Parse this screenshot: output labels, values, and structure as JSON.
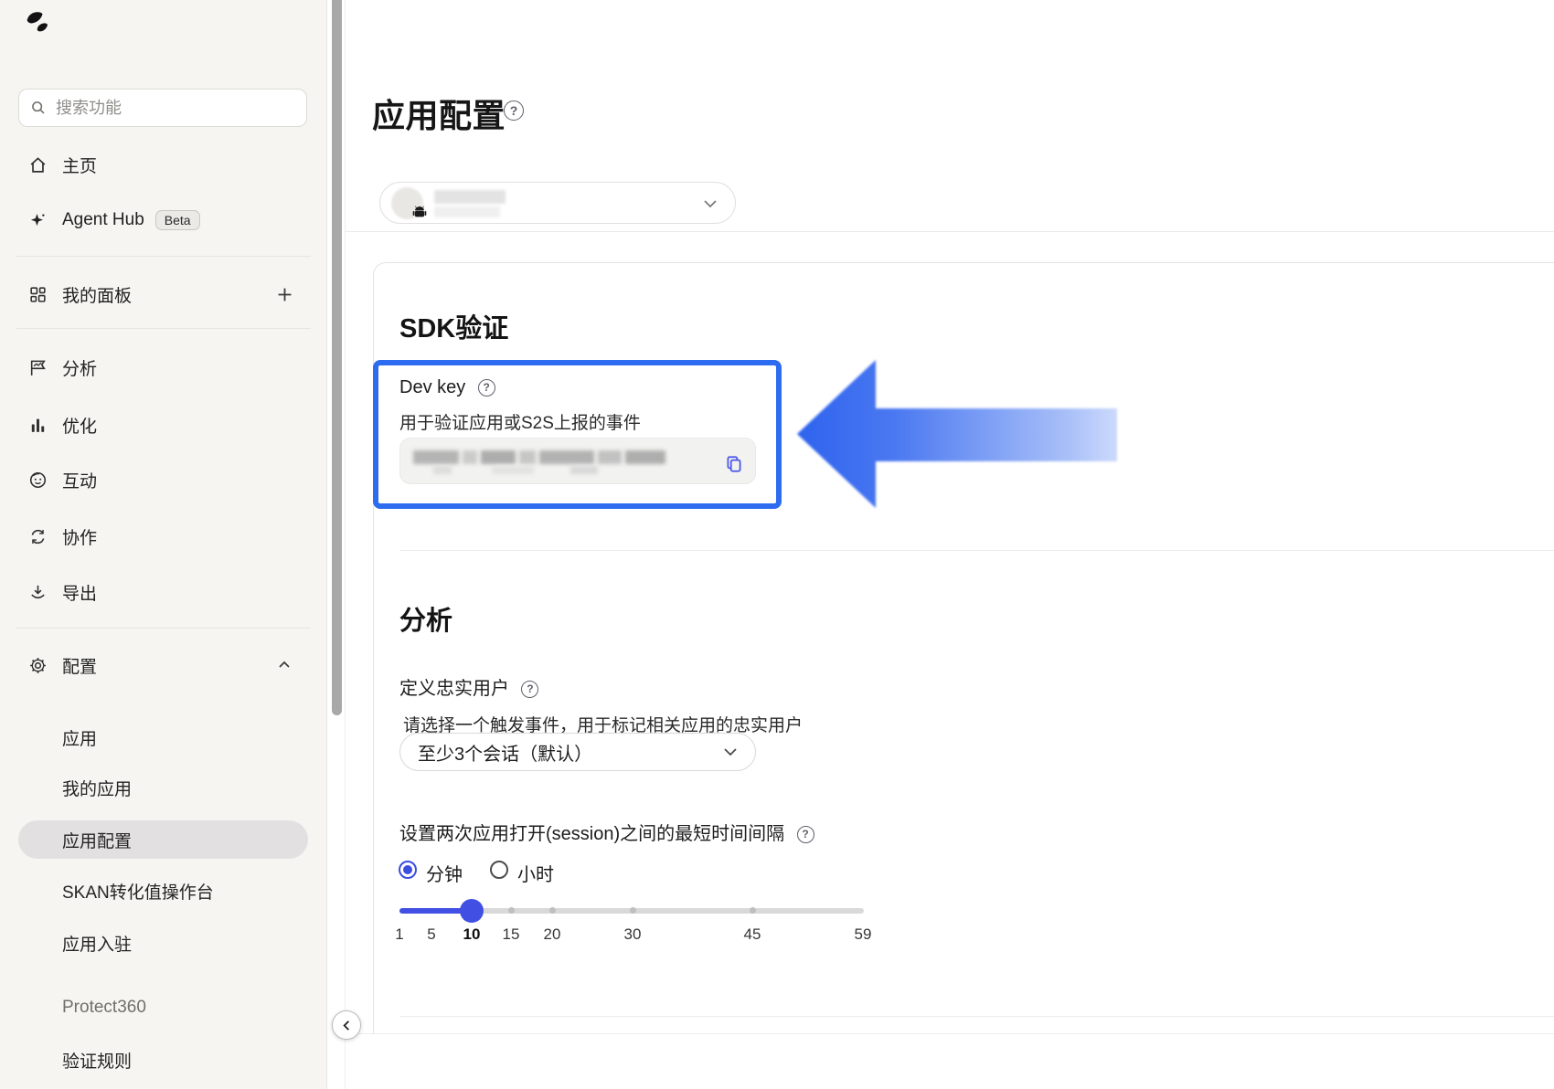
{
  "app": {
    "logo_icon": "appsflyer-logo"
  },
  "sidebar": {
    "search": {
      "placeholder": "搜索功能",
      "icon": "search-icon"
    },
    "items": [
      {
        "label": "主页",
        "icon": "home-icon"
      },
      {
        "label": "Agent Hub",
        "icon": "sparkle-icon",
        "badge": "Beta"
      },
      {
        "label": "我的面板",
        "icon": "dashboard-icon",
        "action_icon": "plus-icon"
      },
      {
        "label": "分析",
        "icon": "flag-chart-icon"
      },
      {
        "label": "优化",
        "icon": "bar-chart-icon"
      },
      {
        "label": "互动",
        "icon": "face-icon"
      },
      {
        "label": "协作",
        "icon": "sync-icon"
      },
      {
        "label": "导出",
        "icon": "export-icon"
      },
      {
        "label": "配置",
        "icon": "gear-icon",
        "state": "expanded",
        "action_icon": "chevron-up-icon"
      }
    ],
    "config_subitems": [
      {
        "label": "应用",
        "selected": false
      },
      {
        "label": "我的应用",
        "selected": false
      },
      {
        "label": "应用配置",
        "selected": true
      },
      {
        "label": "SKAN转化值操作台",
        "selected": false
      },
      {
        "label": "应用入驻",
        "selected": false
      }
    ],
    "sections": [
      {
        "label": "Protect360"
      },
      {
        "label": "验证规则"
      }
    ]
  },
  "main": {
    "page_title": "应用配置",
    "app_selector": {
      "state": "redacted app name",
      "icon": "android-icon"
    },
    "sdk": {
      "title": "SDK验证",
      "dev_key_label": "Dev key",
      "dev_key_desc": "用于验证应用或S2S上报的事件",
      "dev_key_value": "",
      "copy_icon": "copy-icon"
    },
    "analytics": {
      "title": "分析",
      "loyal_label": "定义忠实用户",
      "loyal_hint": "请选择一个触发事件，用于标记相关应用的忠实用户",
      "loyal_value": "至少3个会话（默认）",
      "session_label": "设置两次应用打开(session)之间的最短时间间隔",
      "units": [
        {
          "label": "分钟",
          "selected": true
        },
        {
          "label": "小时",
          "selected": false
        }
      ]
    }
  },
  "slider": {
    "type": "slider",
    "min": 1,
    "max": 59,
    "value": 10,
    "unit": "分钟",
    "ticks": [
      1,
      5,
      10,
      15,
      20,
      30,
      45,
      59
    ]
  },
  "annotation": {
    "shape": "blue highlight box with left-pointing arrow",
    "color": "#2d6bf0"
  },
  "colors": {
    "accent_blue": "#2d6bf0",
    "control_indigo": "#3b4ede",
    "sidebar_bg": "#f6f5f2",
    "selected_pill": "#e2e0e1"
  }
}
